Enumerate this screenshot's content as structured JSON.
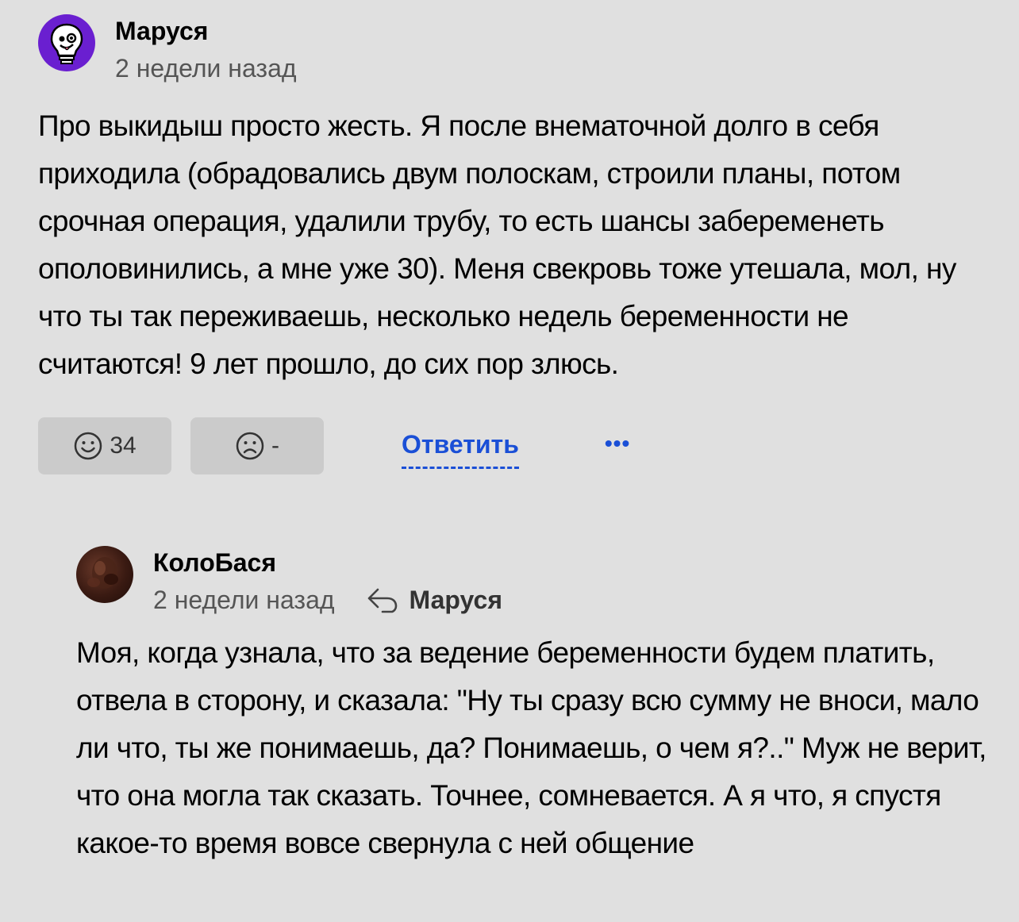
{
  "comments": [
    {
      "author": "Маруся",
      "time": "2 недели назад",
      "text": "Про выкидыш просто жесть. Я после внематочной долго в себя приходила (обрадовались двум полоскам, строили планы, потом срочная операция, удалили трубу, то есть шансы забеременеть ополовинились, а мне уже 30). Меня свекровь тоже утешала, мол, ну что ты так переживаешь, несколько недель беременности не считаются! 9 лет прошло, до сих пор злюсь.",
      "likes": "34",
      "dislikes": "-",
      "reply_label": "Ответить",
      "more_label": "•••"
    },
    {
      "author": "КолоБася",
      "time": "2 недели назад",
      "reply_to": "Маруся",
      "text": "Моя, когда узнала, что за ведение беременности будем платить, отвела в сторону, и сказала: \"Ну ты сразу всю сумму не вноси, мало ли что, ты же понимаешь, да? Понимаешь, о чем я?..\" Муж не верит, что она могла так сказать. Точнее, сомневается. А я что, я спустя какое-то время вовсе свернула с ней общение"
    }
  ],
  "colors": {
    "background": "#e0e0e0",
    "accent": "#1a4fd6",
    "avatar_purple": "#6a1fd0",
    "button_bg": "#cbcbcb"
  },
  "icons": {
    "avatar1": "lightbulb-face-icon",
    "like": "smile-icon",
    "dislike": "frown-icon",
    "reply_to": "reply-arrow-icon"
  }
}
